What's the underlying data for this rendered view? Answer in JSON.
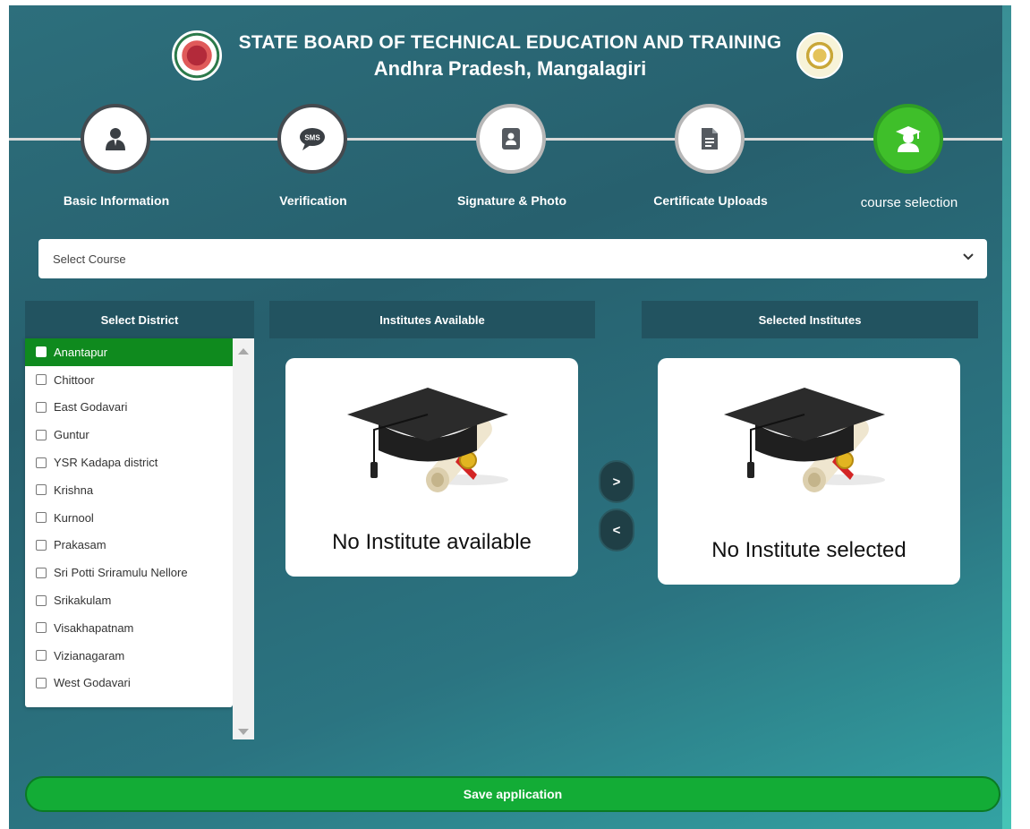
{
  "header": {
    "title": "STATE BOARD OF TECHNICAL EDUCATION AND TRAINING",
    "subtitle": "Andhra Pradesh, Mangalagiri"
  },
  "steps": [
    {
      "label": "Basic Information",
      "icon": "user-icon",
      "state": "done"
    },
    {
      "label": "Verification",
      "icon": "sms-icon",
      "state": "done"
    },
    {
      "label": "Signature & Photo",
      "icon": "id-card-icon",
      "state": "pending"
    },
    {
      "label": "Certificate Uploads",
      "icon": "document-icon",
      "state": "pending"
    },
    {
      "label": "course selection",
      "icon": "graduate-icon",
      "state": "active"
    }
  ],
  "course_select": {
    "value": "Select Course"
  },
  "district_panel": {
    "title": "Select District",
    "items": [
      "Anantapur",
      "Chittoor",
      "East Godavari",
      "Guntur",
      "YSR Kadapa district",
      "Krishna",
      "Kurnool",
      "Prakasam",
      "Sri Potti Sriramulu Nellore",
      "Srikakulam",
      "Visakhapatnam",
      "Vizianagaram",
      "West Godavari"
    ],
    "selected": "Anantapur"
  },
  "available_panel": {
    "title": "Institutes Available",
    "empty_text": "No Institute available"
  },
  "selected_panel": {
    "title": "Selected Institutes",
    "empty_text": "No Institute selected"
  },
  "move_buttons": {
    "add": ">",
    "remove": "<"
  },
  "save_button": {
    "label": "Save application"
  },
  "colors": {
    "active_step": "#3fbf2a",
    "save": "#13ac36",
    "selected_row": "#0f8a1e",
    "panel_header": "#225360"
  }
}
